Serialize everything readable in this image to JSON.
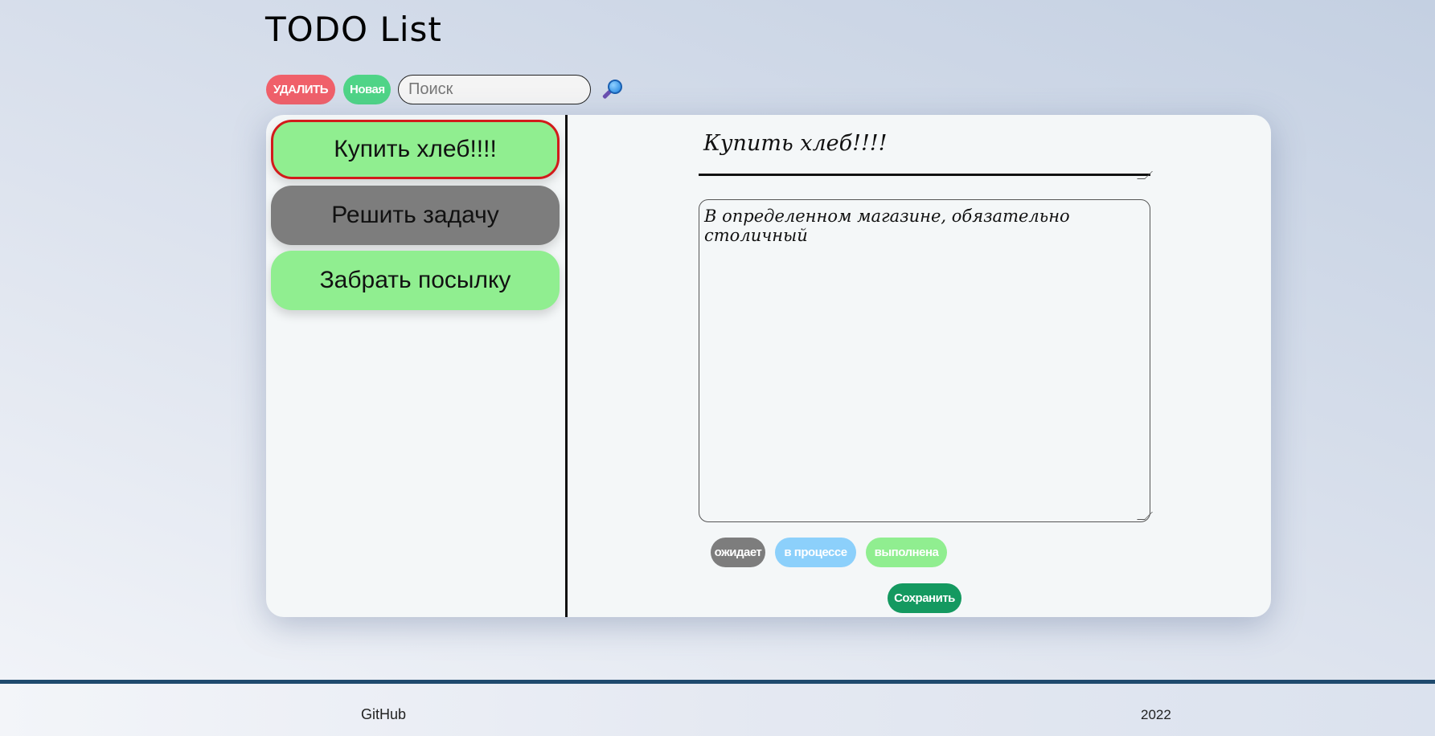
{
  "header": {
    "title": "TODO List"
  },
  "toolbar": {
    "delete_label": "УДАЛИТЬ",
    "new_label": "Новая",
    "search_placeholder": "Поиск",
    "search_value": ""
  },
  "tasks": [
    {
      "label": "Купить хлеб!!!!",
      "color": "#90ee90",
      "selected": true
    },
    {
      "label": "Решить задачу",
      "color": "#7d7d7d",
      "selected": false
    },
    {
      "label": "Забрать посылку",
      "color": "#90ee90",
      "selected": false
    }
  ],
  "editor": {
    "title_value": "Купить хлеб!!!!",
    "description_value": "В определенном магазине, обязательно столичный"
  },
  "status": {
    "waiting_label": "ожидает",
    "in_progress_label": "в процессе",
    "done_label": "выполнена"
  },
  "save_label": "Сохранить",
  "footer": {
    "github_label": "GitHub",
    "year": "2022"
  },
  "colors": {
    "delete": "#f0606a",
    "new": "#4fd487",
    "save": "#149960",
    "selected_border": "#d21b1b"
  }
}
